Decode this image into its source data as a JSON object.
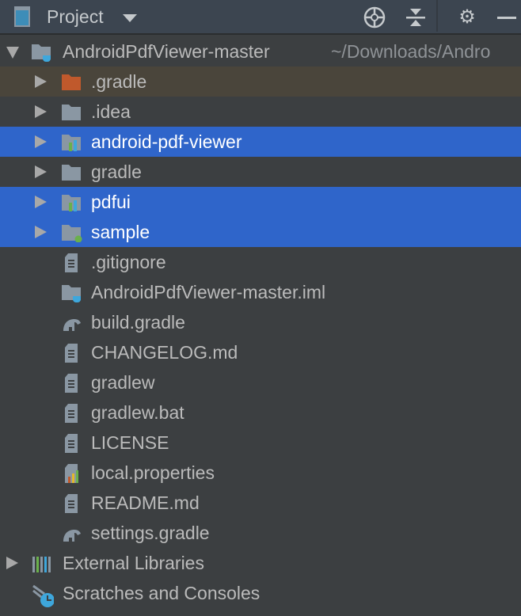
{
  "header": {
    "title": "Project",
    "icons": [
      "locate-icon",
      "collapse-all-icon",
      "gear-icon",
      "minimize-icon"
    ]
  },
  "tree": {
    "root": {
      "label": "AndroidPdfViewer-master",
      "path": "~/Downloads/Andro"
    },
    "items": [
      {
        "label": ".gradle",
        "icon": "folder-excluded-icon"
      },
      {
        "label": ".idea",
        "icon": "folder-icon"
      },
      {
        "label": "android-pdf-viewer",
        "icon": "module-folder-icon",
        "selected": true
      },
      {
        "label": "gradle",
        "icon": "folder-icon"
      },
      {
        "label": "pdfui",
        "icon": "module-folder-icon",
        "selected": true
      },
      {
        "label": "sample",
        "icon": "app-module-folder-icon",
        "selected": true
      },
      {
        "label": ".gitignore",
        "icon": "file-icon"
      },
      {
        "label": "AndroidPdfViewer-master.iml",
        "icon": "iml-icon"
      },
      {
        "label": "build.gradle",
        "icon": "gradle-icon"
      },
      {
        "label": "CHANGELOG.md",
        "icon": "file-icon"
      },
      {
        "label": "gradlew",
        "icon": "file-icon"
      },
      {
        "label": "gradlew.bat",
        "icon": "file-icon"
      },
      {
        "label": "LICENSE",
        "icon": "file-icon"
      },
      {
        "label": "local.properties",
        "icon": "properties-icon"
      },
      {
        "label": "README.md",
        "icon": "file-icon"
      },
      {
        "label": "settings.gradle",
        "icon": "gradle-icon"
      }
    ],
    "external": "External Libraries",
    "scratches": "Scratches and Consoles"
  },
  "colors": {
    "selection": "#2f65ca",
    "excluded": "#4a453b",
    "background": "#3c3f41"
  }
}
